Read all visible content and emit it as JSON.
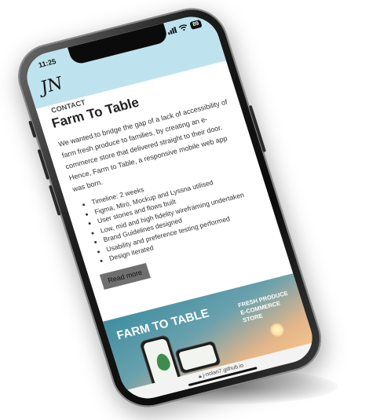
{
  "status_bar": {
    "time": "11:25",
    "battery": "89"
  },
  "header": {
    "logo_text": "JN",
    "nav_link": "CONTACT"
  },
  "project": {
    "title": "Farm To Table",
    "description": "We wanted to bridge the gap of a lack of accessibility of farm fresh produce to families, by creating an e-commerce store that delivered straight to their door. Hence, Farm to Table, a responsive mobile web app was born.",
    "bullets": [
      "Timeline: 2 weeks",
      "Figma, Miro, Mockup and Lyssna utilised",
      "User stories and flows built",
      "Low, mid and high fidelity wireframing undertaken",
      "Brand Guidelines designed",
      "Usability and preference testing performed",
      "Design iterated"
    ],
    "read_more_label": "Read more"
  },
  "banner": {
    "title": "FARM TO TABLE",
    "subtitle_lines": [
      "FRESH PRODUCE",
      "E-COMMERCE",
      "STORE"
    ]
  },
  "browser": {
    "url": "j-nolan7.github.io"
  },
  "colors": {
    "nav_band": "#bfe3ee",
    "read_more_bg": "#6f6f6f",
    "banner_sky": "#3f8ea2",
    "banner_sunset": "#f3c48c"
  }
}
